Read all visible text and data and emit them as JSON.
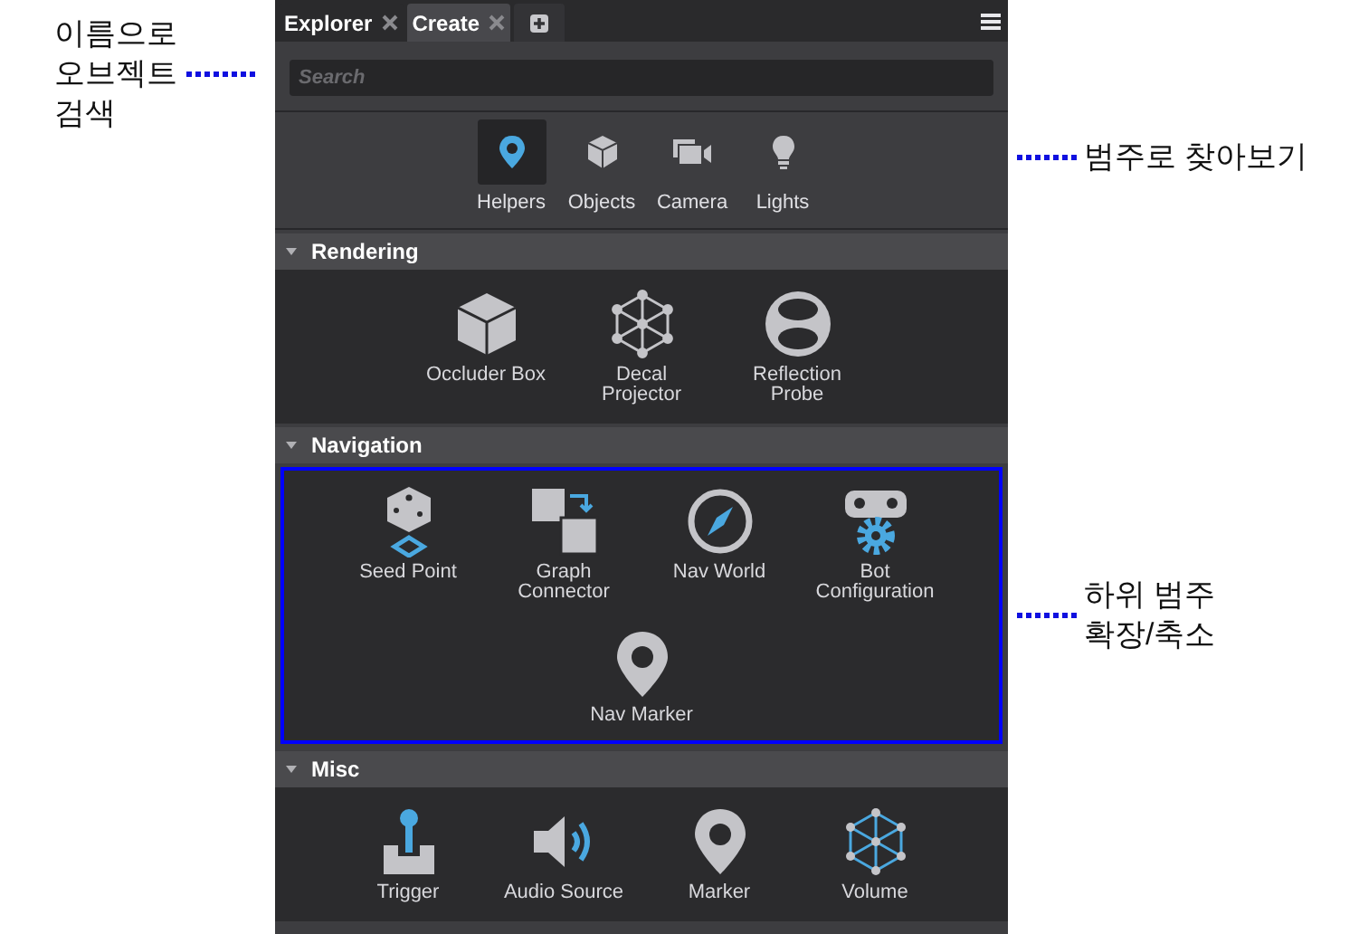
{
  "tabs": [
    {
      "label": "Explorer",
      "selected": false
    },
    {
      "label": "Create",
      "selected": true
    }
  ],
  "search": {
    "placeholder": "Search"
  },
  "categories": [
    {
      "label": "Helpers",
      "selected": true
    },
    {
      "label": "Objects",
      "selected": false
    },
    {
      "label": "Camera",
      "selected": false
    },
    {
      "label": "Lights",
      "selected": false
    }
  ],
  "sections": [
    {
      "title": "Rendering",
      "expanded": true,
      "highlighted": false,
      "items": [
        "Occluder Box",
        "Decal\nProjector",
        "Reflection\nProbe"
      ]
    },
    {
      "title": "Navigation",
      "expanded": true,
      "highlighted": true,
      "items": [
        "Seed Point",
        "Graph\nConnector",
        "Nav World",
        "Bot\nConfiguration",
        "Nav Marker"
      ]
    },
    {
      "title": "Misc",
      "expanded": true,
      "highlighted": false,
      "items": [
        "Trigger",
        "Audio Source",
        "Marker",
        "Volume"
      ]
    }
  ],
  "annotations": [
    {
      "text": "이름으로\n오브젝트\n검색",
      "kind": "left"
    },
    {
      "text": "범주로 찾아보기",
      "kind": "right"
    },
    {
      "text": "하위 범주\n확장/축소",
      "kind": "right"
    }
  ]
}
